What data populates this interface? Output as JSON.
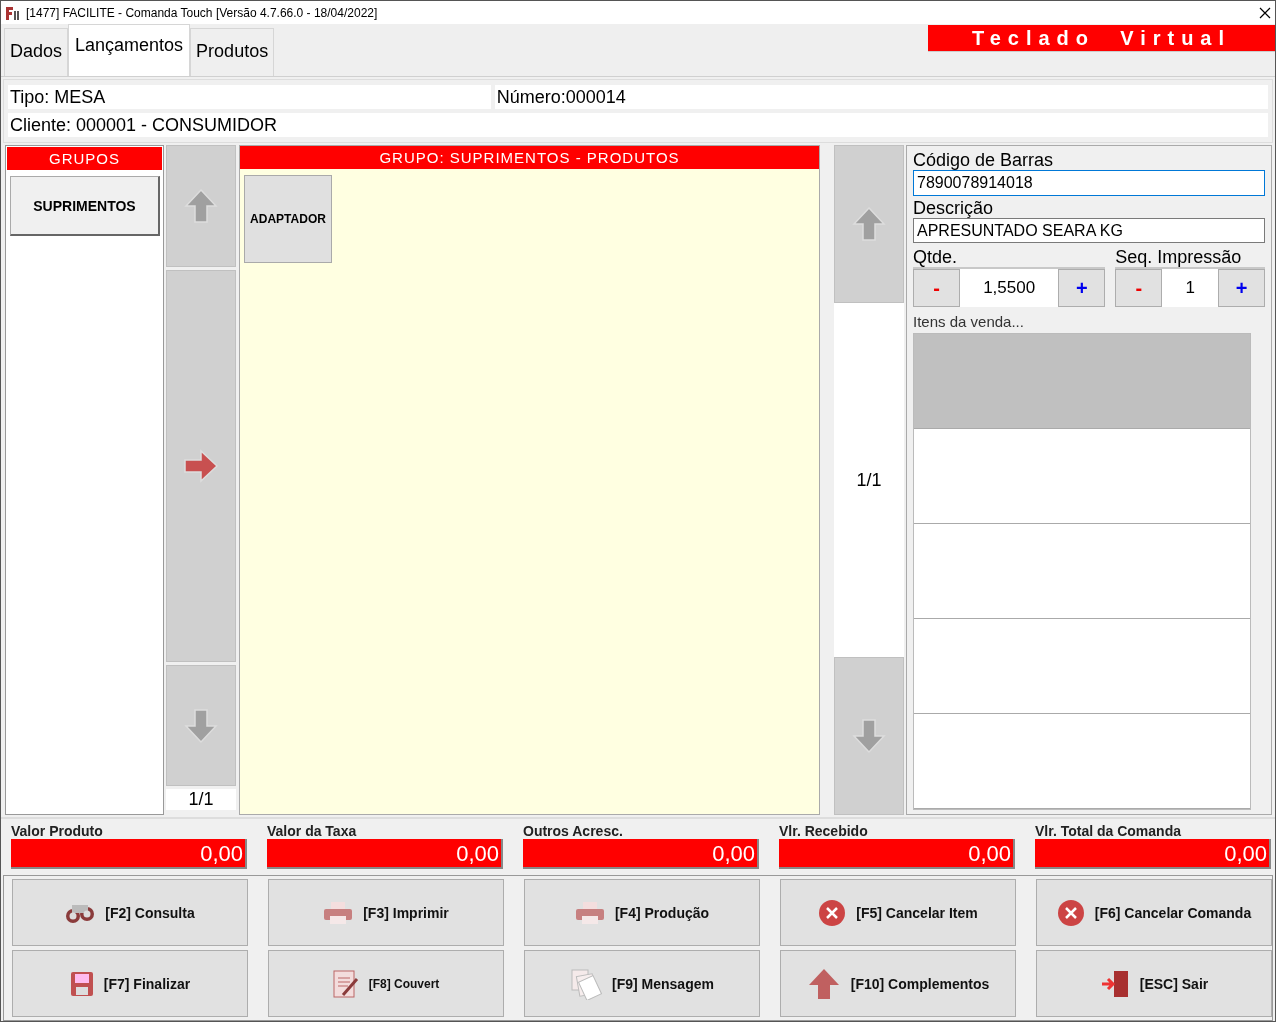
{
  "window": {
    "title": "[1477] FACILITE - Comanda Touch [Versão 4.7.66.0 - 18/04/2022]"
  },
  "tabs": [
    {
      "label": "Dados",
      "selected": false
    },
    {
      "label": "Lançamentos",
      "selected": true
    },
    {
      "label": "Produtos",
      "selected": false
    }
  ],
  "virtual_keyboard_button": "Teclado  Virtual",
  "info": {
    "tipo": "Tipo: MESA",
    "numero": "Número:000014",
    "cliente": "Cliente: 000001 - CONSUMIDOR"
  },
  "groups": {
    "header": "GRUPOS",
    "items": [
      {
        "label": "SUPRIMENTOS"
      }
    ],
    "page": "1/1"
  },
  "products": {
    "header": "GRUPO: SUPRIMENTOS - PRODUTOS",
    "items": [
      {
        "label": "ADAPTADOR"
      }
    ],
    "page": "1/1"
  },
  "item_form": {
    "barcode_label": "Código de Barras",
    "barcode_value": "7890078914018",
    "description_label": "Descrição",
    "description_value": "APRESUNTADO SEARA KG",
    "qty_label": "Qtde.",
    "qty_minus": "-",
    "qty_value": "1,5500",
    "qty_plus": "+",
    "seq_label": "Seq. Impressão",
    "seq_minus": "-",
    "seq_value": "1",
    "seq_plus": "+",
    "items_legend": "Itens da venda...",
    "items_rows": [
      {
        "selected": true
      },
      {
        "selected": false
      },
      {
        "selected": false
      },
      {
        "selected": false
      },
      {
        "selected": false
      }
    ]
  },
  "totals": [
    {
      "label": "Valor Produto",
      "value": "0,00"
    },
    {
      "label": "Valor da Taxa",
      "value": "0,00"
    },
    {
      "label": "Outros Acresc.",
      "value": "0,00"
    },
    {
      "label": "Vlr. Recebido",
      "value": "0,00"
    },
    {
      "label": "Vlr. Total da Comanda",
      "value": "0,00"
    }
  ],
  "actions": [
    {
      "label": "[F2] Consulta",
      "kind": "binoculars"
    },
    {
      "label": "[F3] Imprimir",
      "kind": "printer"
    },
    {
      "label": "[F4] Produção",
      "kind": "printer"
    },
    {
      "label": "[F5] Cancelar Item",
      "kind": "cancel"
    },
    {
      "label": "[F6] Cancelar Comanda",
      "kind": "cancel"
    },
    {
      "label": "[F7] Finalizar",
      "kind": "disk"
    },
    {
      "label": "[F8] Couvert",
      "kind": "note",
      "small": true
    },
    {
      "label": "[F9] Mensagem",
      "kind": "papers"
    },
    {
      "label": "[F10] Complementos",
      "kind": "uparrow"
    },
    {
      "label": "[ESC] Sair",
      "kind": "exit"
    }
  ]
}
